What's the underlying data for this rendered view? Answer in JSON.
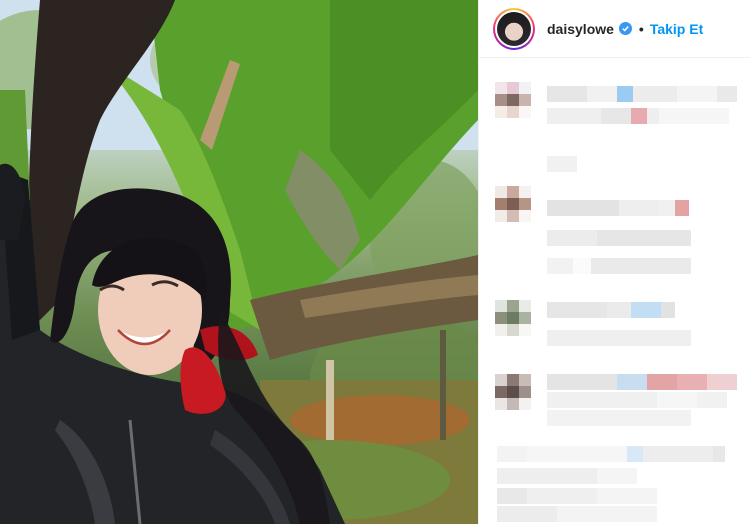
{
  "post": {
    "photo_alt": "daisylowe post photo",
    "author": {
      "username": "daisylowe",
      "verified": true,
      "follow_label": "Takip Et",
      "separator": "•"
    }
  },
  "colors": {
    "follow_blue": "#0095f6",
    "verified_blue": "#3897f0",
    "username": "#262626",
    "divider": "#efefef"
  },
  "icons": [
    "verified-badge-icon",
    "avatar-story-ring"
  ],
  "comments_state": "pixelated"
}
